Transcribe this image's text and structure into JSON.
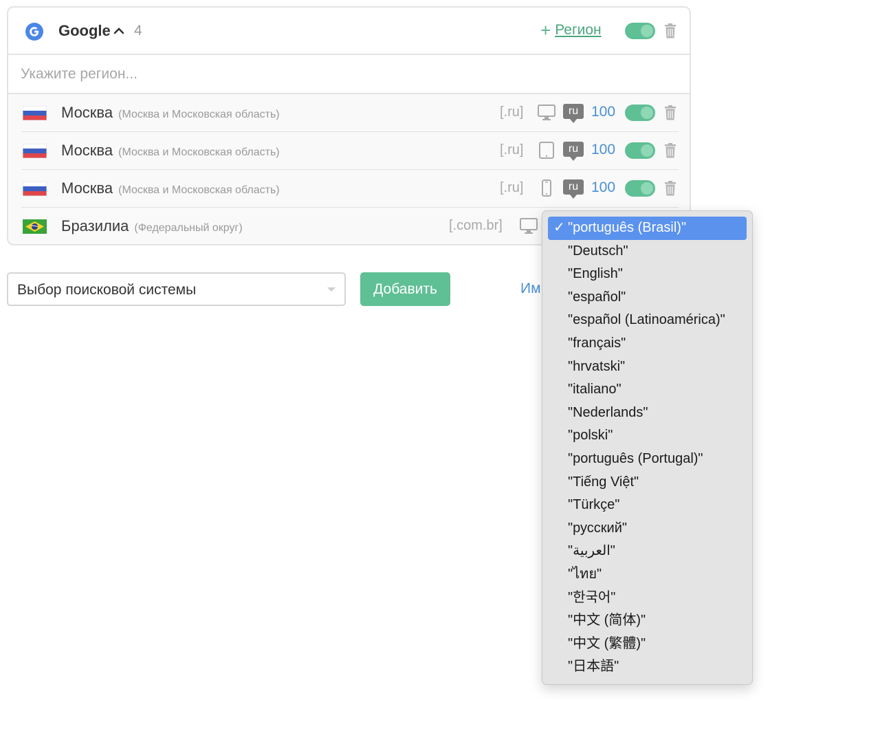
{
  "engine": {
    "name": "Google",
    "count": "4",
    "add_region_label": "Регион",
    "region_placeholder": "Укажите регион..."
  },
  "rows": [
    {
      "city": "Москва",
      "region": "(Москва и Московская область)",
      "domain": "[.ru]",
      "device": "desktop-icon",
      "lang": "ru",
      "depth": "100",
      "flag": "russia"
    },
    {
      "city": "Москва",
      "region": "(Москва и Московская область)",
      "domain": "[.ru]",
      "device": "tablet-icon",
      "lang": "ru",
      "depth": "100",
      "flag": "russia"
    },
    {
      "city": "Москва",
      "region": "(Москва и Московская область)",
      "domain": "[.ru]",
      "device": "phone-icon",
      "lang": "ru",
      "depth": "100",
      "flag": "russia"
    },
    {
      "city": "Бразилиа",
      "region": "(Федеральный округ)",
      "domain": "[.com.br]",
      "device": "desktop-icon",
      "flag": "brazil"
    }
  ],
  "controls": {
    "engine_select_label": "Выбор поисковой системы",
    "add_button": "Добавить",
    "import_link": "Им"
  },
  "dropdown": {
    "selected_index": 0,
    "check": "✓",
    "options": [
      "\"português (Brasil)\"",
      "\"Deutsch\"",
      "\"English\"",
      "\"español\"",
      "\"español (Latinoamérica)\"",
      "\"français\"",
      "\"hrvatski\"",
      "\"italiano\"",
      "\"Nederlands\"",
      "\"polski\"",
      "\"português (Portugal)\"",
      "\"Tiếng Việt\"",
      "\"Türkçe\"",
      "\"русский\"",
      "\"العربية\"",
      "\"ไทย\"",
      "\"한국어\"",
      "\"中文 (简体)\"",
      "\"中文 (繁體)\"",
      "\"日本語\""
    ]
  },
  "colors": {
    "accent_green": "#5fbf95",
    "link_blue": "#4a8fd6",
    "selection_blue": "#5b92ee"
  }
}
